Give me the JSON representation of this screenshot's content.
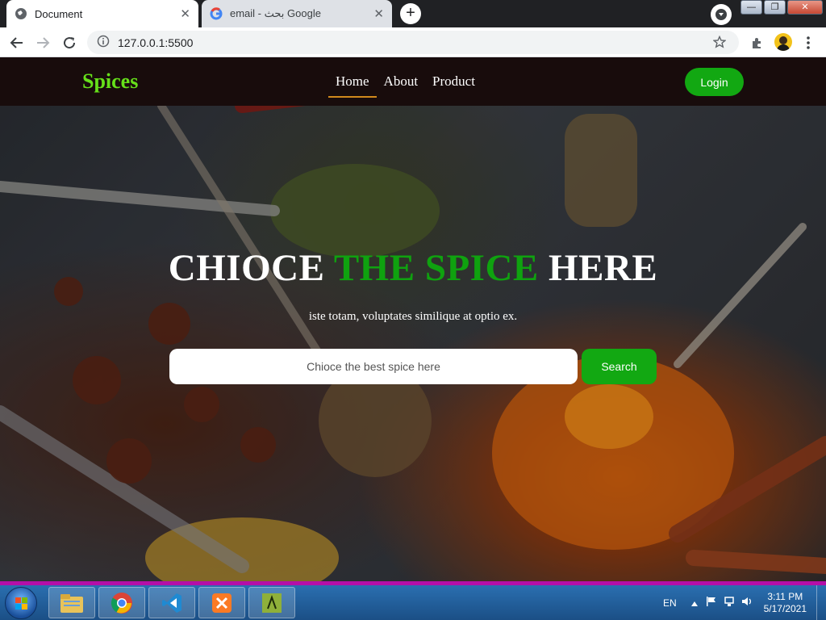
{
  "browser": {
    "tabs": [
      {
        "title": "Document",
        "favicon": "globe-icon",
        "active": true
      },
      {
        "title": "email - بحث Google",
        "favicon": "google-icon",
        "active": false
      }
    ],
    "close_glyph": "✕",
    "new_tab_glyph": "+",
    "url": "127.0.0.1:5500",
    "window_controls": {
      "minimize": "—",
      "maximize": "❐",
      "close": "✕"
    }
  },
  "site": {
    "logo": "Spices",
    "nav": [
      {
        "label": "Home",
        "current": true
      },
      {
        "label": "About",
        "current": false
      },
      {
        "label": "Product",
        "current": false
      }
    ],
    "login_label": "Login",
    "hero": {
      "title_part1": "CHIOCE ",
      "title_accent": "THE SPICE",
      "title_part2": " HERE",
      "subtitle": "iste totam, voluptates similique at optio ex.",
      "search_placeholder": "Chioce the best spice here",
      "search_button": "Search"
    },
    "colors": {
      "accent_green": "#12a812",
      "logo_green": "#66e01a",
      "navbar": "#180c0c",
      "nav_underline": "#d18a1d"
    }
  },
  "taskbar": {
    "apps": [
      "file-explorer-icon",
      "chrome-icon",
      "vscode-icon",
      "xampp-icon",
      "app-icon"
    ],
    "language": "EN",
    "time": "3:11 PM",
    "date": "5/17/2021"
  }
}
